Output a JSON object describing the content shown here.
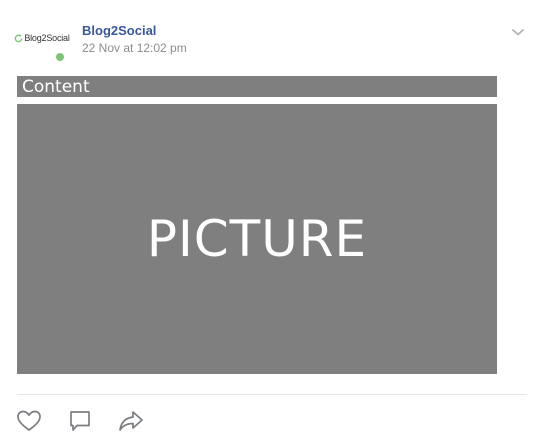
{
  "post": {
    "author": "Blog2Social",
    "timestamp": "22 Nov at 12:02 pm",
    "avatar": {
      "logo_text": "Blog2Social",
      "status": "online",
      "status_color": "#7cc576"
    },
    "content_text": "Content",
    "picture_label": "PICTURE",
    "placeholder_color": "#7f7f7f"
  },
  "actions": {
    "icons": [
      "heart-icon",
      "comment-icon",
      "share-icon"
    ]
  },
  "colors": {
    "author": "#385898",
    "timestamp": "#8a8d91",
    "logo_green": "#7cc576"
  }
}
